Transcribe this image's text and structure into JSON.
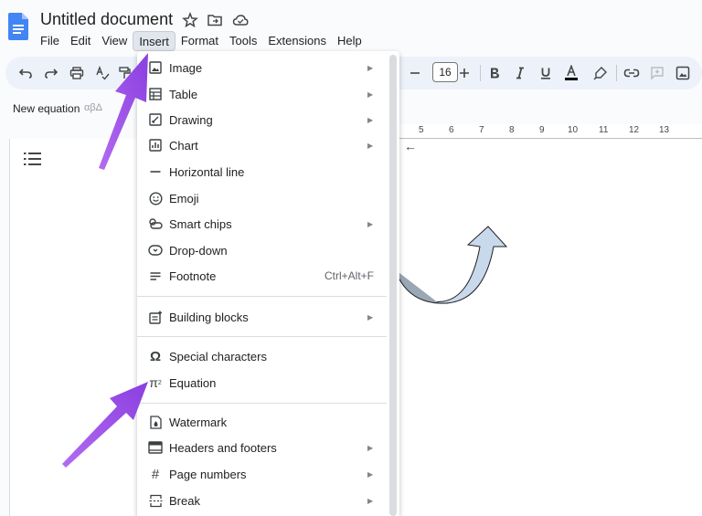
{
  "window": {
    "doc_title": "Untitled document"
  },
  "menubar": {
    "items": [
      "File",
      "Edit",
      "View",
      "Insert",
      "Format",
      "Tools",
      "Extensions",
      "Help"
    ],
    "active": "Insert"
  },
  "toolbar": {
    "font_size": "16"
  },
  "equation_bar": {
    "new_equation_label": "New equation",
    "greek_label": "αβΔ"
  },
  "ruler": {
    "numbers": [
      "5",
      "6",
      "7",
      "8",
      "9",
      "10",
      "11",
      "12",
      "13"
    ]
  },
  "insert_menu": {
    "items": [
      {
        "label": "Image",
        "icon": "image-icon",
        "submenu": true
      },
      {
        "label": "Table",
        "icon": "table-icon",
        "submenu": true
      },
      {
        "label": "Drawing",
        "icon": "drawing-icon",
        "submenu": true
      },
      {
        "label": "Chart",
        "icon": "chart-icon",
        "submenu": true
      },
      {
        "label": "Horizontal line",
        "icon": "horizontal-line-icon",
        "submenu": false
      },
      {
        "label": "Emoji",
        "icon": "emoji-icon",
        "submenu": false
      },
      {
        "label": "Smart chips",
        "icon": "smart-chips-icon",
        "submenu": true
      },
      {
        "label": "Drop-down",
        "icon": "dropdown-icon",
        "submenu": false
      },
      {
        "label": "Footnote",
        "icon": "footnote-icon",
        "submenu": false,
        "shortcut": "Ctrl+Alt+F"
      },
      {
        "label": "Building blocks",
        "icon": "building-blocks-icon",
        "submenu": true
      },
      {
        "label": "Special characters",
        "icon": "omega-icon",
        "submenu": false
      },
      {
        "label": "Equation",
        "icon": "pi-icon",
        "submenu": false
      },
      {
        "label": "Watermark",
        "icon": "watermark-icon",
        "submenu": false
      },
      {
        "label": "Headers and footers",
        "icon": "headers-footers-icon",
        "submenu": true
      },
      {
        "label": "Page numbers",
        "icon": "hash-icon",
        "submenu": true
      },
      {
        "label": "Break",
        "icon": "break-icon",
        "submenu": true
      }
    ]
  },
  "colors": {
    "annotation_arrow": "#9b4dea",
    "doc_blue": "#4285f4",
    "menu_active_bg": "#e1e6ed",
    "toolbar_bg": "#edf2fa",
    "drawing_fill": "#c9d9ec"
  }
}
